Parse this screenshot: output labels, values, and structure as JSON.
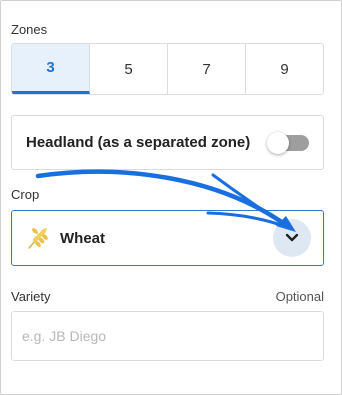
{
  "zones": {
    "label": "Zones",
    "options": [
      "3",
      "5",
      "7",
      "9"
    ],
    "selected": "3"
  },
  "headland": {
    "label": "Headland (as a separated zone)",
    "enabled": false
  },
  "crop": {
    "label": "Crop",
    "value": "Wheat",
    "icon": "wheat-icon"
  },
  "variety": {
    "label": "Variety",
    "optional_label": "Optional",
    "value": "",
    "placeholder": "e.g. JB Diego"
  },
  "colors": {
    "accent": "#1f73c9",
    "annotation_arrow": "#1a6fe0"
  }
}
